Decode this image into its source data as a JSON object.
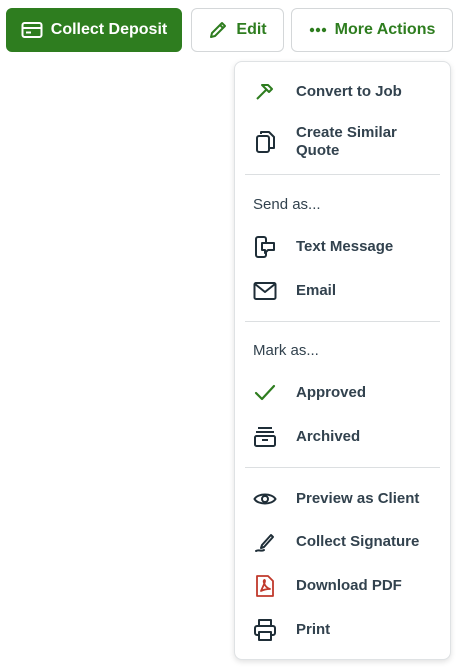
{
  "toolbar": {
    "collect_deposit_label": "Collect Deposit",
    "edit_label": "Edit",
    "more_actions_label": "More Actions"
  },
  "menu": {
    "convert_to_job": "Convert to Job",
    "create_similar_quote": "Create Similar Quote",
    "send_as_label": "Send as...",
    "text_message": "Text Message",
    "email": "Email",
    "mark_as_label": "Mark as...",
    "approved": "Approved",
    "archived": "Archived",
    "preview_as_client": "Preview as Client",
    "collect_signature": "Collect Signature",
    "download_pdf": "Download PDF",
    "print": "Print"
  },
  "colors": {
    "primary_green": "#2e7d1f",
    "text_dark": "#32424e",
    "pdf_red": "#c0392b"
  },
  "icons": {
    "collect_deposit": "credit-card-icon",
    "edit": "pencil-icon",
    "more_actions": "ellipsis-icon",
    "convert_to_job": "hammer-icon",
    "create_similar_quote": "copy-icon",
    "text_message": "sms-icon",
    "email": "envelope-icon",
    "approved": "checkmark-icon",
    "archived": "archive-icon",
    "preview_as_client": "eye-icon",
    "collect_signature": "signature-pen-icon",
    "download_pdf": "pdf-icon",
    "print": "printer-icon"
  }
}
